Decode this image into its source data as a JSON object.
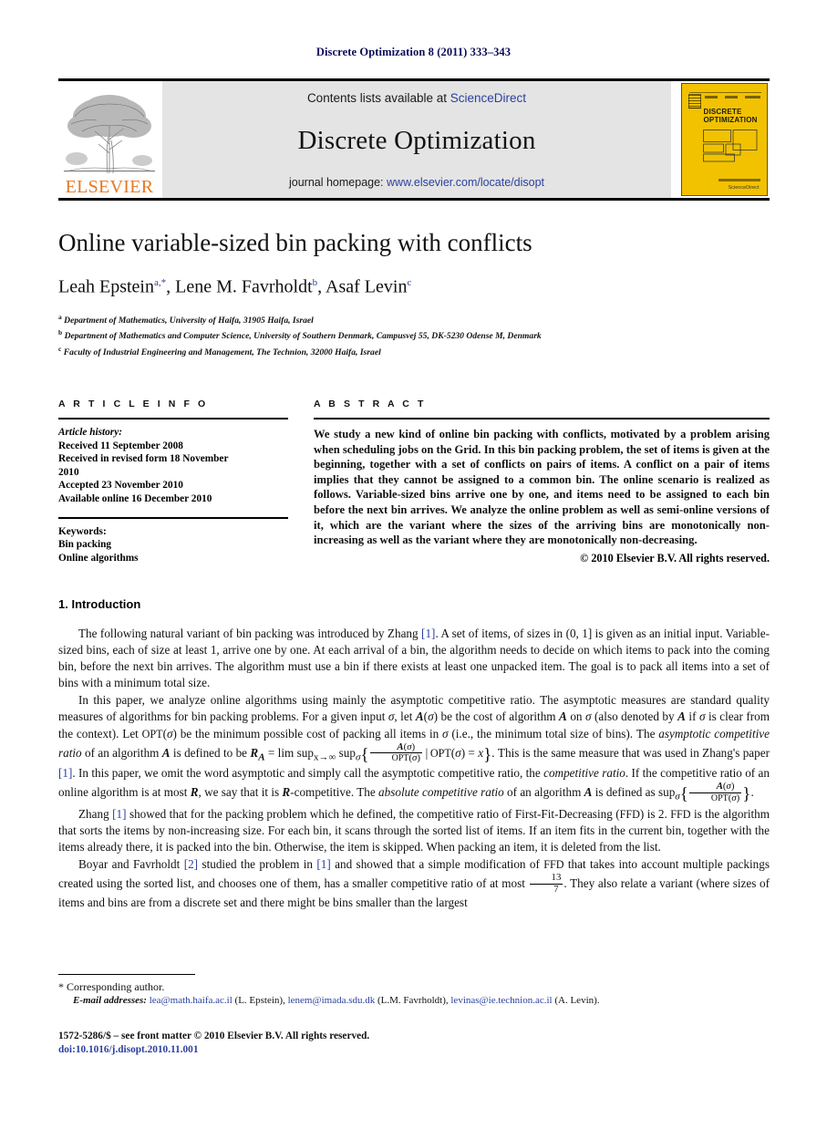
{
  "running_head": "Discrete Optimization 8 (2011) 333–343",
  "masthead": {
    "elsevier_wordmark": "ELSEVIER",
    "contents_prefix": "Contents lists available at ",
    "contents_link": "ScienceDirect",
    "journal_name": "Discrete Optimization",
    "homepage_prefix": "journal homepage: ",
    "homepage_url": "www.elsevier.com/locate/disopt",
    "cover": {
      "title_line1": "DISCRETE",
      "title_line2": "OPTIMIZATION",
      "footer_text": "ScienceDirect"
    }
  },
  "article": {
    "title": "Online variable-sized bin packing with conflicts",
    "authors": [
      {
        "name": "Leah Epstein",
        "marks": "a,*"
      },
      {
        "name": "Lene M. Favrholdt",
        "marks": "b"
      },
      {
        "name": "Asaf Levin",
        "marks": "c"
      }
    ],
    "affiliations": [
      {
        "mark": "a",
        "text": "Department of Mathematics, University of Haifa, 31905 Haifa, Israel"
      },
      {
        "mark": "b",
        "text": "Department of Mathematics and Computer Science, University of Southern Denmark, Campusvej 55, DK-5230 Odense M, Denmark"
      },
      {
        "mark": "c",
        "text": "Faculty of Industrial Engineering and Management, The Technion, 32000 Haifa, Israel"
      }
    ]
  },
  "info": {
    "heading": "A R T I C L E   I N F O",
    "history_label": "Article history:",
    "history": [
      "Received 11 September 2008",
      "Received in revised form 18 November",
      "2010",
      "Accepted 23 November 2010",
      "Available online 16 December 2010"
    ],
    "keywords_label": "Keywords:",
    "keywords": [
      "Bin packing",
      "Online algorithms"
    ]
  },
  "abstract": {
    "heading": "A B S T R A C T",
    "text": "We study a new kind of online bin packing with conflicts, motivated by a problem arising when scheduling jobs on the Grid. In this bin packing problem, the set of items is given at the beginning, together with a set of conflicts on pairs of items. A conflict on a pair of items implies that they cannot be assigned to a common bin. The online scenario is realized as follows. Variable-sized bins arrive one by one, and items need to be assigned to each bin before the next bin arrives. We analyze the online problem as well as semi-online versions of it, which are the variant where the sizes of the arriving bins are monotonically non-increasing as well as the variant where they are monotonically non-decreasing.",
    "copyright": "© 2010 Elsevier B.V. All rights reserved."
  },
  "section": {
    "heading": "1. Introduction",
    "paragraphs": {
      "p1_a": "The following natural variant of bin packing was introduced by Zhang ",
      "p1_ref": "[1]",
      "p1_b": ". A set of items, of sizes in (0, 1] is given as an initial input. Variable-sized bins, each of size at least 1, arrive one by one. At each arrival of a bin, the algorithm needs to decide on which items to pack into the coming bin, before the next bin arrives. The algorithm must use a bin if there exists at least one unpacked item. The goal is to pack all items into a set of bins with a minimum total size.",
      "p2_a": "In this paper, we analyze online algorithms using mainly the asymptotic competitive ratio. The asymptotic measures are standard quality measures of algorithms for bin packing problems. For a given input ",
      "p2_b": ", let ",
      "p2_c": " be the cost of algorithm ",
      "p2_d": " on ",
      "p2_e": " (also denoted by ",
      "p2_f": " if ",
      "p2_g": " is clear from the context). Let ",
      "p2_h": " be the minimum possible cost of packing all items in ",
      "p2_i": " (i.e., the minimum total size of bins). The ",
      "p2_italic1": "asymptotic competitive ratio",
      "p2_j": " of an algorithm ",
      "p2_k": " is defined to be",
      "p2_formula_lead": " = lim sup",
      "p2_formula_sub": "x→∞",
      "p2_formula_sup": "sup",
      "p2_l": ". This is the same measure that was used in Zhang's paper ",
      "p2_ref2": "[1]",
      "p2_m": ". In this paper, we omit the word asymptotic and simply call the asymptotic competitive ratio, the ",
      "p2_italic2": "competitive ratio",
      "p2_n": ". If the competitive ratio of an online algorithm is at most ",
      "p2_o": ", we say that it is ",
      "p2_p": "-competitive. The ",
      "p2_italic3": "absolute competitive ratio",
      "p2_q": " of an algorithm ",
      "p2_r": " is defined as sup",
      "p3_a": "Zhang ",
      "p3_ref": "[1]",
      "p3_b": " showed that for the packing problem which he defined, the competitive ratio of First-Fit-Decreasing (",
      "p3_ffd1": "FFD",
      "p3_c": ") is 2. ",
      "p3_ffd2": "FFD",
      "p3_d": " is the algorithm that sorts the items by non-increasing size. For each bin, it scans through the sorted list of items. If an item fits in the current bin, together with the items already there, it is packed into the bin. Otherwise, the item is skipped. When packing an item, it is deleted from the list.",
      "p4_a": "Boyar and Favrholdt ",
      "p4_ref1": "[2]",
      "p4_b": " studied the problem in ",
      "p4_ref2": "[1]",
      "p4_c": " and showed that a simple modification of ",
      "p4_ffd": "FFD",
      "p4_d": " that takes into account multiple packings created using the sorted list, and chooses one of them, has a smaller competitive ratio of at most ",
      "p4_frac_num": "13",
      "p4_frac_den": "7",
      "p4_e": ". They also relate a variant (where sizes of items and bins are from a discrete set and there might be bins smaller than the largest"
    },
    "symbols": {
      "sigma": "σ",
      "calA": "A",
      "calR": "R",
      "opt": "OPT",
      "x": "x"
    }
  },
  "footnotes": {
    "corresponding": "* Corresponding author.",
    "email_label": "E-mail addresses:",
    "emails": [
      {
        "address": "lea@math.haifa.ac.il",
        "who": "(L. Epstein)"
      },
      {
        "address": "lenem@imada.sdu.dk",
        "who": "(L.M. Favrholdt)"
      },
      {
        "address": "levinas@ie.technion.ac.il",
        "who": "(A. Levin)"
      }
    ]
  },
  "imprint": {
    "line1": "1572-5286/$ – see front matter © 2010 Elsevier B.V. All rights reserved.",
    "doi": "doi:10.1016/j.disopt.2010.11.001"
  },
  "colors": {
    "link": "#2b3f9e",
    "elsevier_orange": "#E87722",
    "cover_yellow": "#f2c200",
    "band_grey": "#e4e4e4"
  }
}
